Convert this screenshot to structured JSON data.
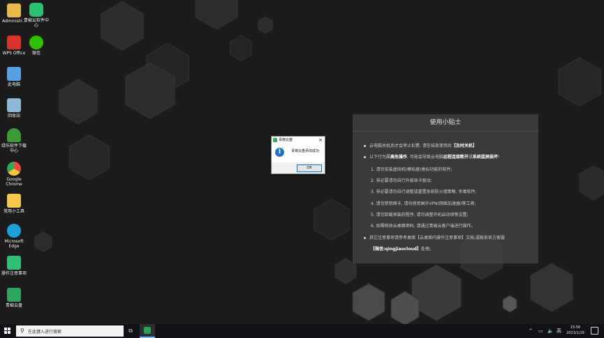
{
  "desktop": {
    "icons": [
      {
        "label": "Administr...",
        "icon": "folder-user-icon",
        "color": "#e7b84a"
      },
      {
        "label": "青椒云软件中心",
        "icon": "qingjiao-softcenter-icon",
        "color": "#2fbf73"
      },
      {
        "label": "WPS Office",
        "icon": "wps-office-icon",
        "color": "#d9342b"
      },
      {
        "label": "微信",
        "icon": "wechat-icon",
        "color": "#2dc100"
      },
      {
        "label": "此电脑",
        "icon": "this-pc-icon",
        "color": "#5aa0e0"
      },
      {
        "label": "回收站",
        "icon": "recycle-bin-icon",
        "color": "#8fb7d6"
      },
      {
        "label": "绿乐软件下载中心",
        "icon": "tree-download-icon",
        "color": "#3d9a3a"
      },
      {
        "label": "Google Chrome",
        "icon": "chrome-icon",
        "color": "#e84a3c"
      },
      {
        "label": "常用小工具",
        "icon": "tools-icon",
        "color": "#f3c84b"
      },
      {
        "label": "Microsoft Edge",
        "icon": "edge-icon",
        "color": "#1d9fd8"
      },
      {
        "label": "操作注意事项",
        "icon": "help-doc-icon",
        "color": "#2fbf73"
      },
      {
        "label": "青椒云盘",
        "icon": "qingjiao-disk-icon",
        "color": "#2fa55f"
      }
    ]
  },
  "tips": {
    "title": "使用小贴士",
    "b1_pre": "云电脑关机后才会停止扣费, 请在结束使用后",
    "b1_bold": "【及时关机】",
    "b2_pre": "以下行为属",
    "b2_bold1": "高危操作",
    "b2_mid": ", 可能会导致云电脑",
    "b2_bold2": "远程连接断开",
    "b2_mid2": "或",
    "b2_bold3": "系统蓝屏损坏",
    "b2_end": "!",
    "items": [
      "1. 请勿安装虚拟机(模拟器)类似功能的软件;",
      "2. 非必要请勿自行升级显卡驱动;",
      "3. 非必要请勿自行调整或重置系统防火墙策略, 杀毒软件;",
      "4. 请勿禁用网卡, 请勿使用国外VPN(网络加速器)等工具;",
      "5. 请勿卸载预装的程序, 请勿调整开机启动项等设置;",
      "6. 如需修改云桌面密码, 请通过青椒云客户端进行操作。"
    ],
    "b3_line1": "其它注意事项请参考桌面【云桌面内操作注意事项】文档,或联系官方客服",
    "b3_line2_bold": "【微信:qingjiaocloud】",
    "b3_line2_end": "处理。"
  },
  "dialog": {
    "title": "青椒云盘",
    "close": "×",
    "message": "青椒云盘添加成功",
    "ok": "OK"
  },
  "taskbar": {
    "search_placeholder": "在此键入进行搜索",
    "tray_up": "^",
    "tray_network": "▭",
    "tray_volume": "🔈",
    "tray_ime": "英",
    "time": "15:56",
    "date": "2023/1/19"
  }
}
